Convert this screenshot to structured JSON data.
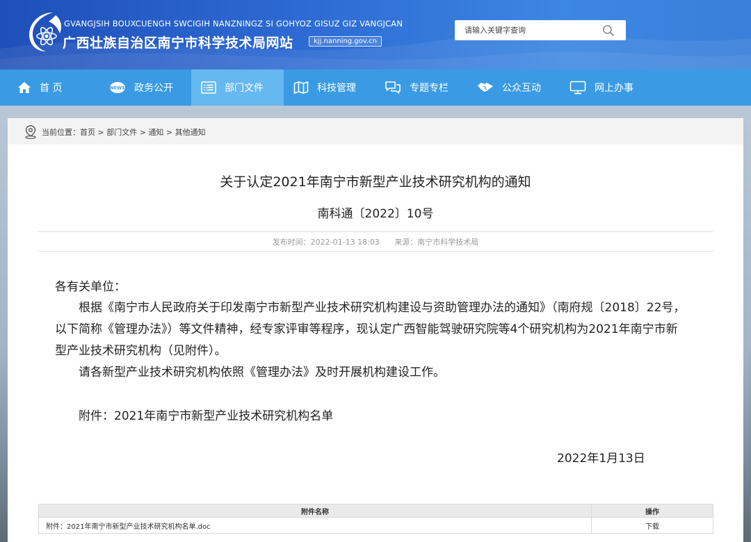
{
  "header": {
    "site_name_en": "GVANGJSIH BOUXCUENGH SWCIGIH NANZNINGZ SI GOHYOZ GISUZ GIZ VANGJCAN",
    "site_name_cn": "广西壮族自治区南宁市科学技术局网站",
    "domain": "kjj.nanning.gov.cn",
    "logo_icon": "atom-emblem-icon"
  },
  "search": {
    "placeholder": "请输入关键字查询",
    "icon": "search-icon"
  },
  "nav": {
    "items": [
      {
        "label": "首 页",
        "icon": "home-icon"
      },
      {
        "label": "政务公开",
        "icon": "news-icon"
      },
      {
        "label": "部门文件",
        "icon": "document-list-icon",
        "active": true
      },
      {
        "label": "科技管理",
        "icon": "map-icon"
      },
      {
        "label": "专题专栏",
        "icon": "chat-icon"
      },
      {
        "label": "公众互动",
        "icon": "handshake-icon"
      },
      {
        "label": "网上办事",
        "icon": "monitor-icon"
      }
    ]
  },
  "breadcrumb": {
    "text": "当前位置：首页 > 部门文件 > 通知 > 其他通知",
    "icon": "location-pin-icon"
  },
  "article": {
    "title": "关于认定2021年南宁市新型产业技术研究机构的通知",
    "doc_number": "南科通〔2022〕10号",
    "publish_time": "发布时间：2022-01-13 18:03",
    "source": "来源：南宁市科学技术局",
    "salutation": "各有关单位：",
    "paragraph1": "　　根据《南宁市人民政府关于印发南宁市新型产业技术研究机构建设与资助管理办法的通知》（南府规〔2018〕22号，以下简称《管理办法》）等文件精神，经专家评审等程序，现认定广西智能驾驶研究院等4个研究机构为2021年南宁市新型产业技术研究机构（见附件）。",
    "paragraph2": "　　请各新型产业技术研究机构依照《管理办法》及时开展机构建设工作。",
    "attachment_line": "　　附件：2021年南宁市新型产业技术研究机构名单",
    "date": "2022年1月13日"
  },
  "attachments": {
    "header_name": "附件名称",
    "header_action": "操作",
    "rows": [
      {
        "name": "附件：2021年南宁市新型产业技术研究机构名单.doc",
        "action": "下载"
      }
    ]
  },
  "colors": {
    "header_blue": "#2d6ad3",
    "nav_blue": "#3a9be4",
    "nav_active": "#66b8f1"
  }
}
